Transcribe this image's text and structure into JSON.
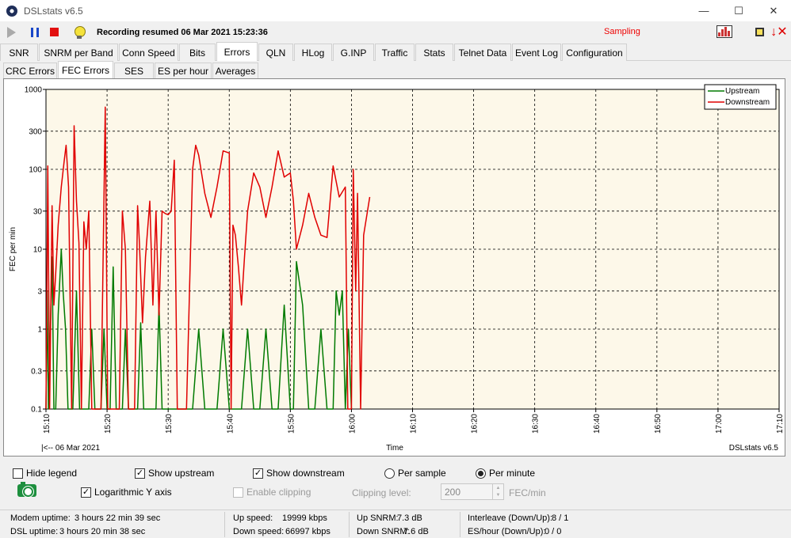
{
  "window": {
    "title": "DSLstats v6.5"
  },
  "toolbar": {
    "status": "Recording resumed 06 Mar 2021 15:23:36",
    "sampling": "Sampling"
  },
  "tabs": [
    "SNR",
    "SNRM per Band",
    "Conn Speed",
    "Bits",
    "Errors",
    "QLN",
    "HLog",
    "G.INP",
    "Traffic",
    "Stats",
    "Telnet Data",
    "Event Log",
    "Configuration"
  ],
  "active_tab": "Errors",
  "subtabs": [
    "CRC Errors",
    "FEC Errors",
    "SES",
    "ES per hour",
    "Averages"
  ],
  "active_subtab": "FEC Errors",
  "chart_data": {
    "type": "line",
    "ylabel": "FEC per min",
    "xlabel": "Time",
    "x_start_label": "|<-- 06 Mar 2021",
    "watermark": "DSLstats v6.5",
    "y_scale": "log",
    "ylim": [
      0.1,
      1000
    ],
    "y_ticks": [
      {
        "v": 1000,
        "label": "1000"
      },
      {
        "v": 300,
        "label": "300"
      },
      {
        "v": 100,
        "label": "100"
      },
      {
        "v": 30,
        "label": "30"
      },
      {
        "v": 10,
        "label": "10"
      },
      {
        "v": 3,
        "label": "3"
      },
      {
        "v": 1,
        "label": "1"
      },
      {
        "v": 0.3,
        "label": "0.3"
      },
      {
        "v": 0.1,
        "label": "0.1"
      }
    ],
    "x_range_min": [
      0,
      120
    ],
    "x_ticks": [
      {
        "m": 0,
        "label": "15:10"
      },
      {
        "m": 10,
        "label": "15:20"
      },
      {
        "m": 20,
        "label": "15:30"
      },
      {
        "m": 30,
        "label": "15:40"
      },
      {
        "m": 40,
        "label": "15:50"
      },
      {
        "m": 50,
        "label": "16:00"
      },
      {
        "m": 60,
        "label": "16:10"
      },
      {
        "m": 70,
        "label": "16:20"
      },
      {
        "m": 80,
        "label": "16:30"
      },
      {
        "m": 90,
        "label": "16:40"
      },
      {
        "m": 100,
        "label": "16:50"
      },
      {
        "m": 110,
        "label": "17:00"
      },
      {
        "m": 120,
        "label": "17:10"
      }
    ],
    "grid": true,
    "legend_position": "top-right",
    "series": [
      {
        "name": "Upstream",
        "color": "#007a00",
        "points": [
          [
            0,
            0.1
          ],
          [
            0.2,
            3
          ],
          [
            0.4,
            0.1
          ],
          [
            0.8,
            2
          ],
          [
            1,
            8
          ],
          [
            1.3,
            0.1
          ],
          [
            1.6,
            0.1
          ],
          [
            2,
            1.5
          ],
          [
            2.5,
            10
          ],
          [
            2.8,
            3
          ],
          [
            3.2,
            1
          ],
          [
            3.6,
            0.1
          ],
          [
            4.4,
            0.1
          ],
          [
            5,
            3
          ],
          [
            5.5,
            0.1
          ],
          [
            7,
            0.1
          ],
          [
            7.5,
            1
          ],
          [
            8,
            0.1
          ],
          [
            9,
            0.1
          ],
          [
            9.5,
            1
          ],
          [
            10,
            0.1
          ],
          [
            10.5,
            0.1
          ],
          [
            11,
            6
          ],
          [
            11.5,
            0.1
          ],
          [
            12.5,
            0.1
          ],
          [
            13,
            1
          ],
          [
            13.5,
            0.1
          ],
          [
            15,
            0.1
          ],
          [
            15.5,
            1.2
          ],
          [
            16,
            0.1
          ],
          [
            18,
            0.1
          ],
          [
            18.5,
            2
          ],
          [
            19,
            0.1
          ],
          [
            24,
            0.1
          ],
          [
            25,
            1
          ],
          [
            26,
            0.1
          ],
          [
            28,
            0.1
          ],
          [
            29,
            1
          ],
          [
            30,
            0.1
          ],
          [
            32,
            0.1
          ],
          [
            33,
            1
          ],
          [
            34,
            0.1
          ],
          [
            35,
            0.1
          ],
          [
            36,
            1
          ],
          [
            37,
            0.1
          ],
          [
            38,
            0.1
          ],
          [
            39,
            2
          ],
          [
            40,
            0.1
          ],
          [
            40.5,
            0.1
          ],
          [
            41,
            7
          ],
          [
            42,
            2
          ],
          [
            43,
            0.1
          ],
          [
            44,
            0.1
          ],
          [
            45,
            1
          ],
          [
            46,
            0.1
          ],
          [
            47,
            0.1
          ],
          [
            47.5,
            3
          ],
          [
            48,
            1.5
          ],
          [
            48.5,
            3
          ],
          [
            49,
            0.1
          ],
          [
            49.5,
            1
          ],
          [
            50,
            0.1
          ]
        ]
      },
      {
        "name": "Downstream",
        "color": "#e00000",
        "points": [
          [
            0,
            0.1
          ],
          [
            0.3,
            110
          ],
          [
            0.6,
            0.1
          ],
          [
            1,
            35
          ],
          [
            1.3,
            2
          ],
          [
            1.6,
            5
          ],
          [
            2,
            20
          ],
          [
            2.5,
            60
          ],
          [
            3,
            130
          ],
          [
            3.3,
            200
          ],
          [
            3.7,
            60
          ],
          [
            4.2,
            0.1
          ],
          [
            4.6,
            350
          ],
          [
            5,
            40
          ],
          [
            5.4,
            12
          ],
          [
            5.8,
            0.1
          ],
          [
            6.2,
            22
          ],
          [
            6.6,
            10
          ],
          [
            7,
            30
          ],
          [
            7.5,
            0.1
          ],
          [
            9,
            0.1
          ],
          [
            9.7,
            600
          ],
          [
            10.1,
            0.1
          ],
          [
            11.5,
            0.1
          ],
          [
            12,
            0.1
          ],
          [
            12.5,
            30
          ],
          [
            13,
            10
          ],
          [
            13.5,
            0.1
          ],
          [
            14.5,
            0.1
          ],
          [
            15,
            35
          ],
          [
            15.3,
            12
          ],
          [
            15.8,
            1.2
          ],
          [
            16.3,
            8
          ],
          [
            17,
            40
          ],
          [
            17.5,
            2
          ],
          [
            18,
            30
          ],
          [
            18.5,
            1.5
          ],
          [
            19,
            30
          ],
          [
            19.5,
            28
          ],
          [
            20,
            27
          ],
          [
            20.5,
            30
          ],
          [
            21,
            130
          ],
          [
            21.5,
            0.1
          ],
          [
            23,
            0.1
          ],
          [
            24,
            100
          ],
          [
            24.5,
            200
          ],
          [
            25,
            150
          ],
          [
            26,
            50
          ],
          [
            27,
            25
          ],
          [
            28,
            60
          ],
          [
            29,
            170
          ],
          [
            30,
            160
          ],
          [
            30.3,
            0.1
          ],
          [
            30.6,
            20
          ],
          [
            31,
            15
          ],
          [
            31.5,
            6
          ],
          [
            32,
            2
          ],
          [
            32.5,
            8
          ],
          [
            33,
            30
          ],
          [
            34,
            90
          ],
          [
            35,
            60
          ],
          [
            36,
            25
          ],
          [
            37,
            60
          ],
          [
            38,
            170
          ],
          [
            39,
            80
          ],
          [
            40,
            90
          ],
          [
            40.5,
            40
          ],
          [
            41,
            10
          ],
          [
            42,
            20
          ],
          [
            43,
            50
          ],
          [
            44,
            25
          ],
          [
            45,
            15
          ],
          [
            46,
            14
          ],
          [
            47,
            110
          ],
          [
            48,
            45
          ],
          [
            49,
            60
          ],
          [
            49.4,
            0.1
          ],
          [
            50,
            0.1
          ],
          [
            50.3,
            100
          ],
          [
            50.7,
            3
          ],
          [
            51,
            50
          ],
          [
            51.5,
            0.1
          ],
          [
            52,
            15
          ],
          [
            53,
            45
          ]
        ]
      }
    ]
  },
  "controls": {
    "hide_legend": "Hide legend",
    "show_upstream": "Show upstream",
    "show_downstream": "Show downstream",
    "per_sample": "Per sample",
    "per_minute": "Per minute",
    "log_y": "Logarithmic Y axis",
    "enable_clipping": "Enable clipping",
    "clipping_level_label": "Clipping level:",
    "clipping_level_value": "200",
    "clipping_unit": "FEC/min"
  },
  "status": {
    "modem_uptime_label": "Modem uptime:",
    "modem_uptime": "3 hours 22 min 39 sec",
    "dsl_uptime_label": "DSL uptime:",
    "dsl_uptime": "3 hours 20 min 38 sec",
    "up_speed_label": "Up speed:",
    "up_speed": "19999 kbps",
    "down_speed_label": "Down speed:",
    "down_speed": "66997 kbps",
    "up_snrm_label": "Up SNRM:",
    "up_snrm": "7.3 dB",
    "down_snrm_label": "Down SNRM:",
    "down_snrm": "7.6 dB",
    "interleave_label": "Interleave (Down/Up):",
    "interleave": "8 / 1",
    "es_hour_label": "ES/hour (Down/Up):",
    "es_hour": "0 / 0"
  }
}
